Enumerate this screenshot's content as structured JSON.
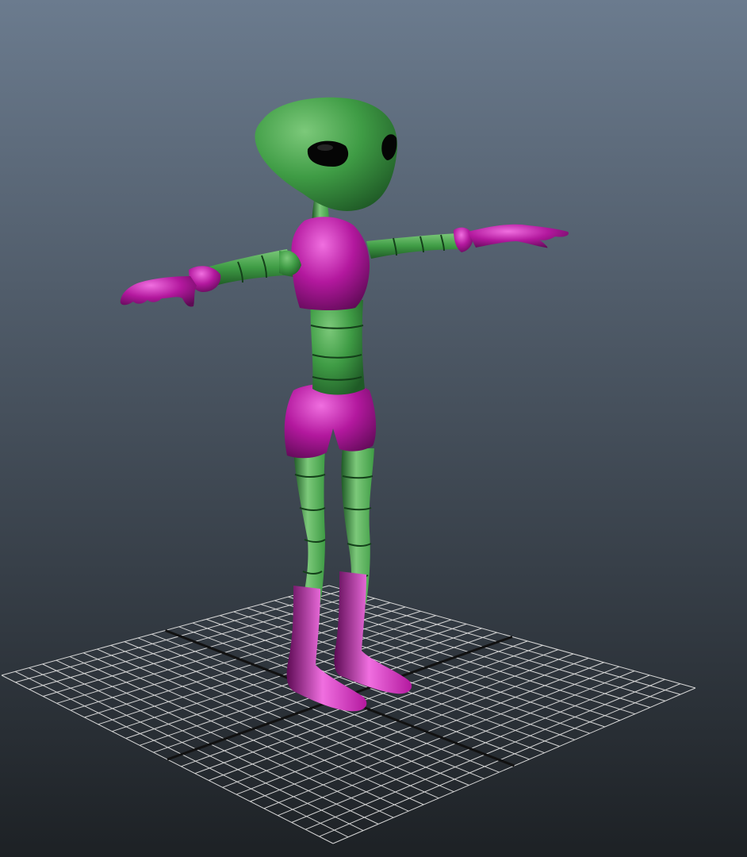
{
  "viewport": {
    "background_top_color": "#6b7b8e",
    "background_bottom_color": "#1d2125"
  },
  "grid": {
    "line_color": "#d6d6d6",
    "axis_color": "#111111",
    "divisions": 24
  },
  "character": {
    "pose": "T-pose",
    "skin_color": "#3f9c45",
    "skin_highlight_color": "#7cc97a",
    "skin_shadow_color": "#1f5a26",
    "clothing_color": "#b3189e",
    "clothing_highlight_color": "#f06fe0",
    "clothing_shadow_color": "#5d0a54",
    "eye_color": "#050505"
  }
}
